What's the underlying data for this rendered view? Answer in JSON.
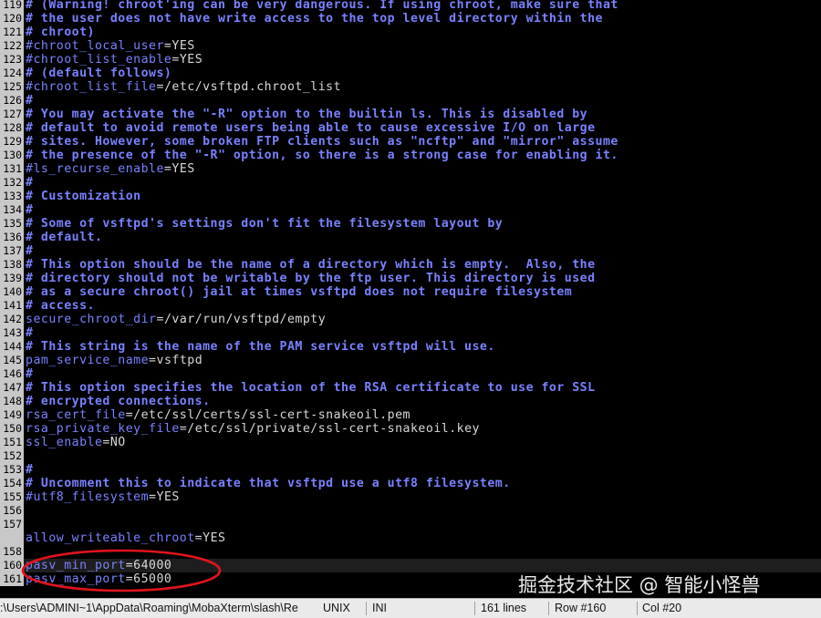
{
  "colors": {
    "background": "#000000",
    "comment": "#7a82ff",
    "text": "#d8d8d8",
    "gutter_bg": "#c8c8c8",
    "annotation": "#e0141c"
  },
  "editor": {
    "lines": [
      {
        "num": "119",
        "type": "comment",
        "text": "# (Warning! chroot'ing can be very dangerous. If using chroot, make sure that"
      },
      {
        "num": "120",
        "type": "comment",
        "text": "# the user does not have write access to the top level directory within the"
      },
      {
        "num": "121",
        "type": "comment",
        "text": "# chroot)"
      },
      {
        "num": "122",
        "type": "kv",
        "key": "#chroot_local_user",
        "value": "YES"
      },
      {
        "num": "123",
        "type": "kv",
        "key": "#chroot_list_enable",
        "value": "YES"
      },
      {
        "num": "124",
        "type": "comment",
        "text": "# (default follows)"
      },
      {
        "num": "125",
        "type": "kv",
        "key": "#chroot_list_file",
        "value": "/etc/vsftpd.chroot_list"
      },
      {
        "num": "126",
        "type": "comment",
        "text": "#"
      },
      {
        "num": "127",
        "type": "comment",
        "text": "# You may activate the \"-R\" option to the builtin ls. This is disabled by"
      },
      {
        "num": "128",
        "type": "comment",
        "text": "# default to avoid remote users being able to cause excessive I/O on large"
      },
      {
        "num": "129",
        "type": "comment",
        "text": "# sites. However, some broken FTP clients such as \"ncftp\" and \"mirror\" assume"
      },
      {
        "num": "130",
        "type": "comment",
        "text": "# the presence of the \"-R\" option, so there is a strong case for enabling it."
      },
      {
        "num": "131",
        "type": "kv",
        "key": "#ls_recurse_enable",
        "value": "YES"
      },
      {
        "num": "132",
        "type": "comment",
        "text": "#"
      },
      {
        "num": "133",
        "type": "comment",
        "text": "# Customization"
      },
      {
        "num": "134",
        "type": "comment",
        "text": "#"
      },
      {
        "num": "135",
        "type": "comment",
        "text": "# Some of vsftpd's settings don't fit the filesystem layout by"
      },
      {
        "num": "136",
        "type": "comment",
        "text": "# default."
      },
      {
        "num": "137",
        "type": "comment",
        "text": "#"
      },
      {
        "num": "138",
        "type": "comment",
        "text": "# This option should be the name of a directory which is empty.  Also, the"
      },
      {
        "num": "139",
        "type": "comment",
        "text": "# directory should not be writable by the ftp user. This directory is used"
      },
      {
        "num": "140",
        "type": "comment",
        "text": "# as a secure chroot() jail at times vsftpd does not require filesystem"
      },
      {
        "num": "141",
        "type": "comment",
        "text": "# access."
      },
      {
        "num": "142",
        "type": "kv",
        "key": "secure_chroot_dir",
        "value": "/var/run/vsftpd/empty"
      },
      {
        "num": "143",
        "type": "comment",
        "text": "#"
      },
      {
        "num": "144",
        "type": "comment",
        "text": "# This string is the name of the PAM service vsftpd will use."
      },
      {
        "num": "145",
        "type": "kv",
        "key": "pam_service_name",
        "value": "vsftpd"
      },
      {
        "num": "146",
        "type": "comment",
        "text": "#"
      },
      {
        "num": "147",
        "type": "comment",
        "text": "# This option specifies the location of the RSA certificate to use for SSL"
      },
      {
        "num": "148",
        "type": "comment",
        "text": "# encrypted connections."
      },
      {
        "num": "149",
        "type": "kv",
        "key": "rsa_cert_file",
        "value": "/etc/ssl/certs/ssl-cert-snakeoil.pem"
      },
      {
        "num": "150",
        "type": "kv",
        "key": "rsa_private_key_file",
        "value": "/etc/ssl/private/ssl-cert-snakeoil.key"
      },
      {
        "num": "151",
        "type": "kv",
        "key": "ssl_enable",
        "value": "NO"
      },
      {
        "num": "152",
        "type": "blank"
      },
      {
        "num": "153",
        "type": "comment",
        "text": "#"
      },
      {
        "num": "154",
        "type": "comment",
        "text": "# Uncomment this to indicate that vsftpd use a utf8 filesystem."
      },
      {
        "num": "155",
        "type": "kv",
        "key": "#utf8_filesystem",
        "value": "YES"
      },
      {
        "num": "156",
        "type": "blank"
      },
      {
        "num": "157",
        "type": "blank"
      },
      {
        "num": "",
        "type": "kv",
        "key": "allow_writeable_chroot",
        "value": "YES",
        "wrapped": true
      },
      {
        "num": "158",
        "type": "blank"
      },
      {
        "num": "160",
        "type": "kv",
        "key": "pasv_min_port",
        "value": "64000",
        "current": true
      },
      {
        "num": "161",
        "type": "kv",
        "key": "pasv_max_port",
        "value": "65000"
      }
    ]
  },
  "status_bar": {
    "path": ":\\Users\\ADMINI~1\\AppData\\Roaming\\MobaXterm\\slash\\Re",
    "eol": "UNIX",
    "syntax": "INI",
    "lines": "161 lines",
    "row": "Row #160",
    "col": "Col #20"
  },
  "watermark": "掘金技术社区 @ 智能小怪兽"
}
